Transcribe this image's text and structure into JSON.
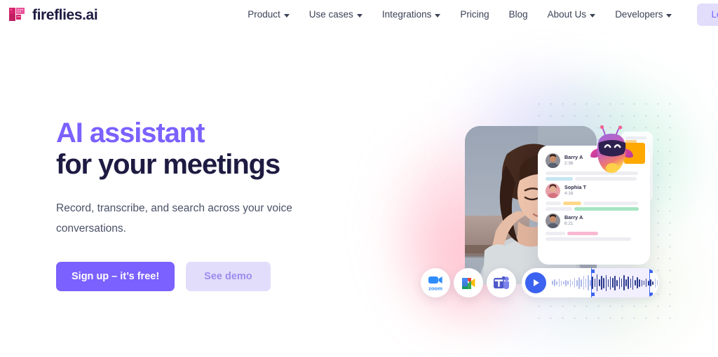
{
  "brand": {
    "name": "fireflies.ai",
    "logo_icon": "fireflies-pixel-logo-icon",
    "primary_color": "#7b61ff",
    "dark_color": "#1e1b42",
    "magenta_color": "#d6246e",
    "pink_color": "#e8539a"
  },
  "nav": {
    "items": [
      {
        "label": "Product",
        "has_caret": true,
        "name": "nav-item-product"
      },
      {
        "label": "Use cases",
        "has_caret": true,
        "name": "nav-item-use-cases"
      },
      {
        "label": "Integrations",
        "has_caret": true,
        "name": "nav-item-integrations"
      },
      {
        "label": "Pricing",
        "has_caret": false,
        "name": "nav-item-pricing"
      },
      {
        "label": "Blog",
        "has_caret": false,
        "name": "nav-item-blog"
      },
      {
        "label": "About Us",
        "has_caret": true,
        "name": "nav-item-about-us"
      },
      {
        "label": "Developers",
        "has_caret": true,
        "name": "nav-item-developers"
      }
    ],
    "login_label": "Login",
    "login_bg": "#e2ddfb",
    "login_color": "#7b61ff"
  },
  "hero": {
    "headline_line1": "AI assistant",
    "headline_line2": "for your meetings",
    "subheadline": "Record, transcribe, and search across your voice conversations.",
    "cta_primary": "Sign up – it’s free!",
    "cta_secondary": "See demo"
  },
  "illustration": {
    "photo_alt": "woman-with-earbuds-photo",
    "mascot_name": "fireflies-robot-mascot",
    "transcript": [
      {
        "speaker": "Barry A",
        "time": "2:36",
        "avatar": "avatar-barry",
        "highlight": "#c6e6f2"
      },
      {
        "speaker": "Sophia T",
        "time": "4:16",
        "avatar": "avatar-sophia",
        "highlight": "#ffd98a"
      },
      {
        "speaker": "Barry A",
        "time": "6:21",
        "avatar": "avatar-barry",
        "highlight": "#f9b8d2"
      }
    ],
    "integrations": [
      {
        "label": "zoom",
        "name": "zoom-icon"
      },
      {
        "label": "Google Meet",
        "name": "google-meet-icon"
      },
      {
        "label": "Microsoft Teams",
        "name": "microsoft-teams-icon"
      }
    ],
    "player": {
      "play_label": "Play",
      "waveform_name": "audio-waveform"
    }
  }
}
